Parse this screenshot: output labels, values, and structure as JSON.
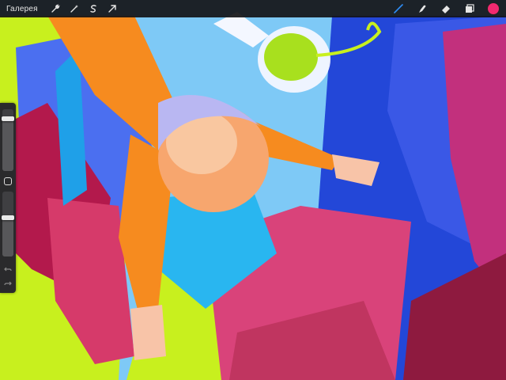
{
  "topbar": {
    "gallery_label": "Галерея",
    "left_tools": [
      {
        "icon": "wrench-icon"
      },
      {
        "icon": "magic-wand-icon"
      },
      {
        "icon": "selection-s-icon"
      },
      {
        "icon": "transform-arrow-icon"
      }
    ],
    "right_tools": [
      {
        "icon": "brush-icon",
        "active_color": "#2f8cf3"
      },
      {
        "icon": "smudge-icon"
      },
      {
        "icon": "eraser-icon"
      },
      {
        "icon": "layers-icon"
      }
    ],
    "current_color": "#f2296f"
  },
  "sidebar": {
    "brush_size_level": 0.85,
    "opacity_level": 0.6
  },
  "colors": {
    "toolbar_bg": "#141416",
    "sky": "#7ec9f6",
    "lime": "#c8f01e",
    "orange": "#f68b1f",
    "royal_blue": "#2347d8",
    "magenta": "#d9437a"
  }
}
